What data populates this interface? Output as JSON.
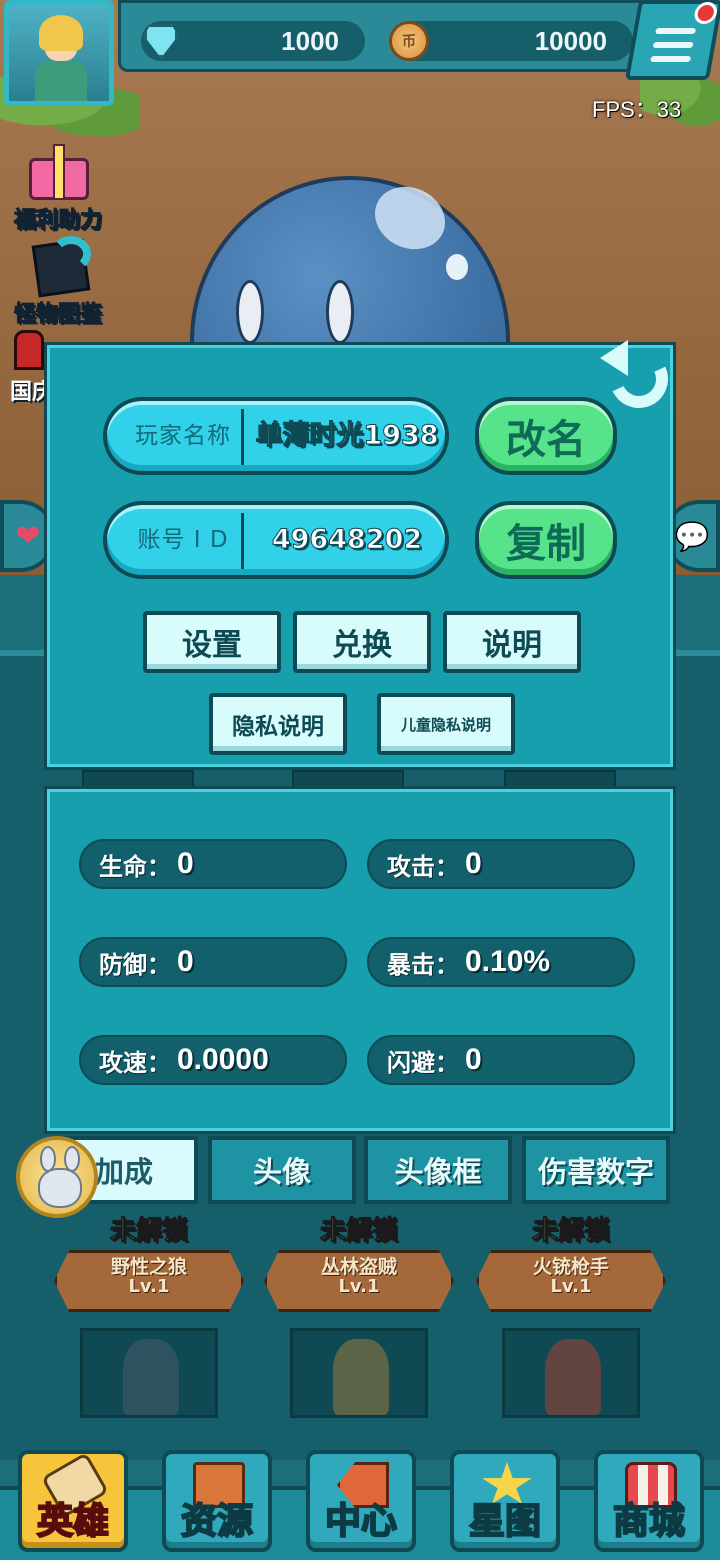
{
  "resources": {
    "diamonds": "1000",
    "coins": "10000",
    "coin_glyph": "币"
  },
  "fps": "FPS：33",
  "side_icons": {
    "gift_label": "福利助力",
    "monster_book_label": "怪物图鉴",
    "third_label_partial": "国庆"
  },
  "profile": {
    "name_label": "玩家名称",
    "name_value": "单薄时光1938",
    "rename_button": "改名",
    "id_label": "账号 I D",
    "id_value": "49648202",
    "copy_button": "复制",
    "settings_button": "设置",
    "redeem_button": "兑换",
    "instructions_button": "说明",
    "privacy_button": "隐私说明",
    "child_privacy_button": "儿童隐私说明"
  },
  "stats": [
    {
      "label": "生命：",
      "value": "0"
    },
    {
      "label": "攻击：",
      "value": "0"
    },
    {
      "label": "防御：",
      "value": "0"
    },
    {
      "label": "暴击：",
      "value": "0.10%"
    },
    {
      "label": "攻速：",
      "value": "0.0000"
    },
    {
      "label": "闪避：",
      "value": "0"
    }
  ],
  "tabs": [
    "加成",
    "头像",
    "头像框",
    "伤害数字"
  ],
  "active_tab": "加成",
  "heroes": [
    {
      "status": "未解锁",
      "name": "野性之狼",
      "level": "Lv.1"
    },
    {
      "status": "未解锁",
      "name": "丛林盗贼",
      "level": "Lv.1"
    },
    {
      "status": "未解锁",
      "name": "火铳枪手",
      "level": "Lv.1"
    }
  ],
  "bottom_nav": [
    {
      "label": "英雄",
      "icon": "scroll-icon"
    },
    {
      "label": "资源",
      "icon": "crate-icon"
    },
    {
      "label": "中心",
      "icon": "arrow-sign-icon"
    },
    {
      "label": "星图",
      "icon": "star-icon"
    },
    {
      "label": "商城",
      "icon": "shop-icon"
    }
  ],
  "active_nav": "英雄",
  "colors": {
    "panel": "#179fae",
    "field": "#32d1ea",
    "green_button": "#57e38a",
    "active_nav": "#f6c53b",
    "dark_outline": "#0d4a54"
  }
}
